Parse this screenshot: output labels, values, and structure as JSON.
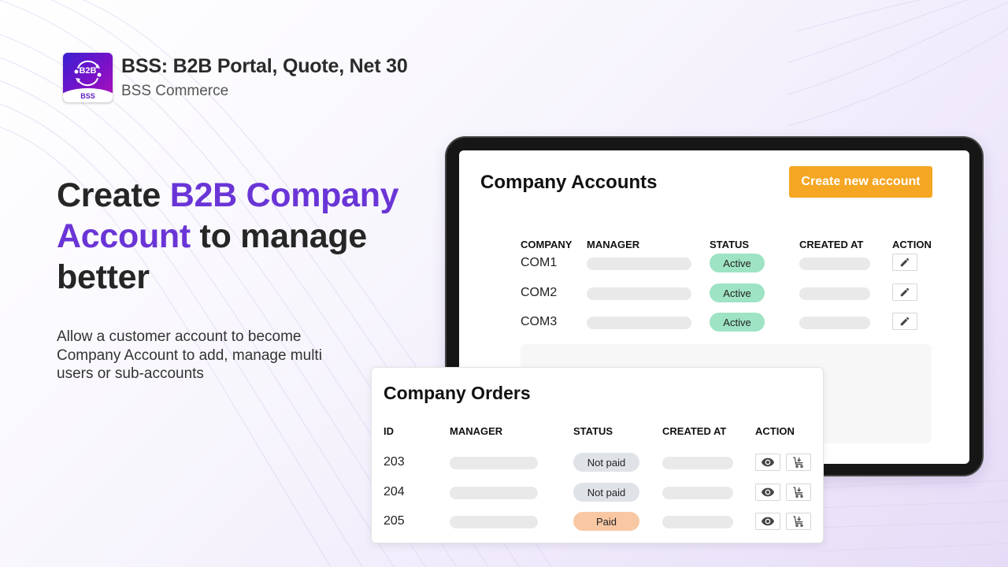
{
  "app": {
    "title": "BSS: B2B Portal, Quote, Net 30",
    "vendor": "BSS Commerce",
    "logo_text": "B2B",
    "logo_label": "BSS"
  },
  "hero": {
    "title_part1": "Create ",
    "title_accent": "B2B Company Account",
    "title_part2": " to manage better",
    "description": "Allow a customer account to become Company Account to add, manage multi users or sub-accounts",
    "accent_color": "#6a35d6"
  },
  "company_accounts": {
    "title": "Company Accounts",
    "create_button": "Create new account",
    "button_color": "#f5a623",
    "columns": [
      "COMPANY",
      "MANAGER",
      "STATUS",
      "CREATED AT",
      "ACTION"
    ],
    "rows": [
      {
        "company": "COM1",
        "status": "Active",
        "action_icon": "edit-icon"
      },
      {
        "company": "COM2",
        "status": "Active",
        "action_icon": "edit-icon"
      },
      {
        "company": "COM3",
        "status": "Active",
        "action_icon": "edit-icon"
      }
    ],
    "status_color": "#9ee3c4"
  },
  "company_orders": {
    "title": "Company Orders",
    "columns": [
      "ID",
      "MANAGER",
      "STATUS",
      "CREATED AT",
      "ACTION"
    ],
    "rows": [
      {
        "id": "203",
        "status": "Not paid",
        "actions": [
          "view-icon",
          "reorder-cart-icon"
        ]
      },
      {
        "id": "204",
        "status": "Not paid",
        "actions": [
          "view-icon",
          "reorder-cart-icon"
        ]
      },
      {
        "id": "205",
        "status": "Paid",
        "actions": [
          "view-icon",
          "reorder-cart-icon"
        ]
      }
    ],
    "status_colors": {
      "Not paid": "#dfe2e7",
      "Paid": "#f8c8a4"
    }
  }
}
